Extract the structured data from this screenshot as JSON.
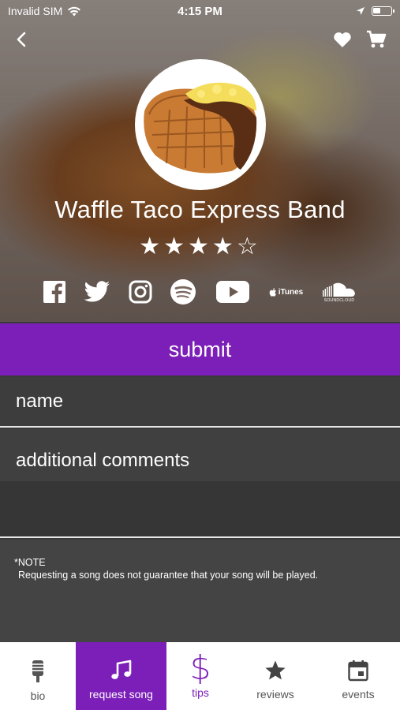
{
  "status_bar": {
    "carrier": "Invalid SIM",
    "time": "4:15 PM"
  },
  "header": {
    "band_name": "Waffle Taco Express Band",
    "rating_stars": "★★★★☆",
    "rating_value": 4,
    "rating_max": 5,
    "socials": [
      "facebook-icon",
      "twitter-icon",
      "instagram-icon",
      "spotify-icon",
      "youtube-icon",
      "itunes-icon",
      "soundcloud-icon"
    ],
    "itunes_label": "iTunes",
    "soundcloud_label": "SOUNDCLOUD"
  },
  "form": {
    "submit_label": "submit",
    "name_placeholder": "name",
    "comments_placeholder": "additional comments"
  },
  "note": {
    "title": "*NOTE",
    "body": "Requesting a song does not guarantee that your song will be played."
  },
  "tabs": [
    {
      "label": "bio",
      "icon": "microphone-icon"
    },
    {
      "label": "request song",
      "icon": "music-note-icon"
    },
    {
      "label": "tips",
      "icon": "dollar-icon"
    },
    {
      "label": "reviews",
      "icon": "star-icon"
    },
    {
      "label": "events",
      "icon": "calendar-icon"
    }
  ],
  "colors": {
    "accent": "#7c1fb8",
    "field_bg": "#3d3d3d",
    "note_bg": "#444444"
  }
}
